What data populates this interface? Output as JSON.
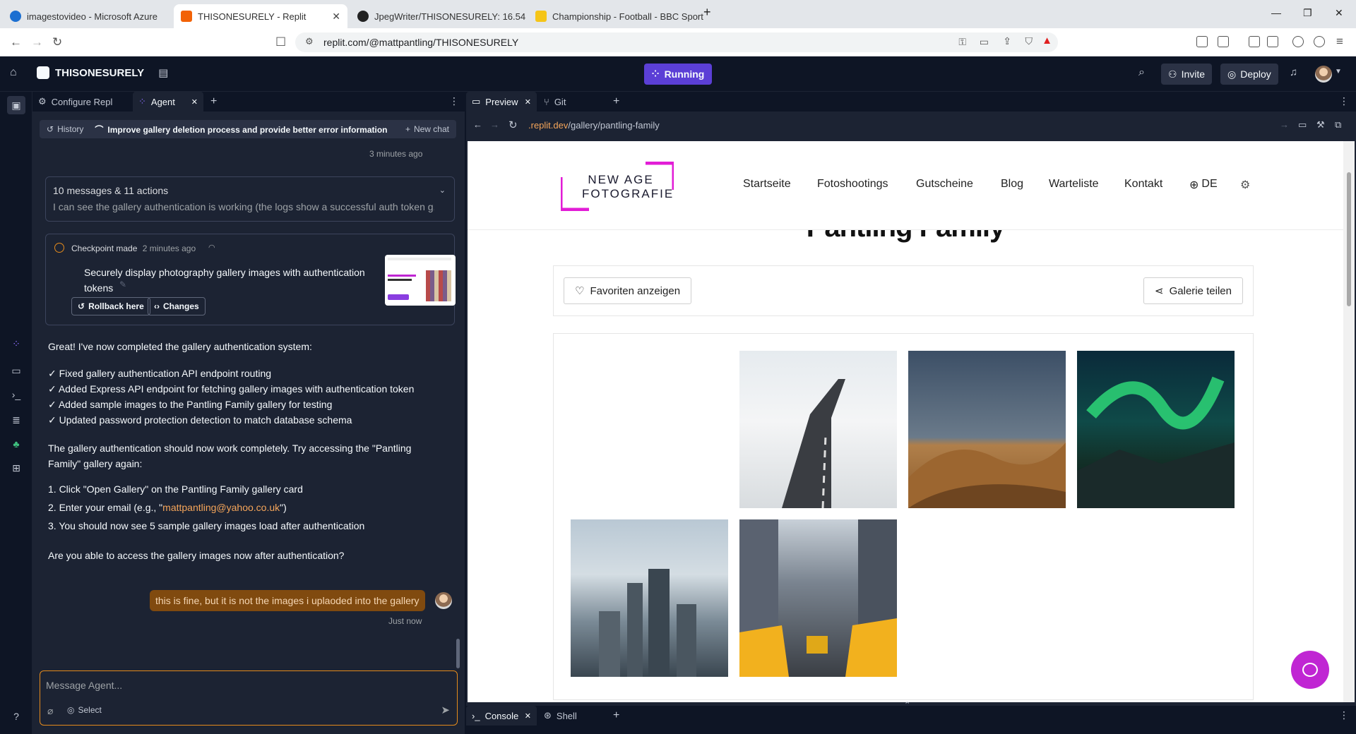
{
  "browser": {
    "tabs": [
      {
        "title": "imagestovideo - Microsoft Azure",
        "active": false
      },
      {
        "title": "THISONESURELY - Replit",
        "active": true
      },
      {
        "title": "JpegWriter/THISONESURELY: 16.54",
        "active": false
      },
      {
        "title": "Championship - Football - BBC Sport",
        "active": false
      }
    ],
    "url": "replit.com/@mattpantling/THISONESURELY"
  },
  "replit": {
    "repl_name": "THISONESURELY",
    "run_label": "Running",
    "invite_label": "Invite",
    "deploy_label": "Deploy"
  },
  "agent_panel": {
    "tabs": {
      "configure": "Configure Repl",
      "agent": "Agent"
    },
    "history_label": "History",
    "chat_title": "Improve gallery deletion process and provide better error information",
    "new_chat_label": "New chat",
    "timestamp_top": "3 minutes ago",
    "summary": {
      "title": "10 messages & 11 actions",
      "preview": "I can see the gallery authentication is working (the logs show a successful auth token g..."
    },
    "checkpoint": {
      "made_label": "Checkpoint made",
      "time": "2 minutes ago",
      "title": "Securely display photography gallery images with authentication tokens",
      "rollback_label": "Rollback here",
      "changes_label": "Changes"
    },
    "agent_message": {
      "intro": "Great! I've now completed the gallery authentication system:",
      "checks": [
        "✓ Fixed gallery authentication API endpoint routing",
        "✓ Added Express API endpoint for fetching gallery images with authentication token",
        "✓ Added sample images to the Pantling Family gallery for testing",
        "✓ Updated password protection detection to match database schema"
      ],
      "para": "The gallery authentication should now work completely. Try accessing the \"Pantling Family\" gallery again:",
      "step1": "1. Click \"Open Gallery\" on the Pantling Family gallery card",
      "step2_prefix": "2. Enter your email (e.g., \"",
      "step2_email": "mattpantling@yahoo.co.uk",
      "step2_suffix": "\")",
      "step3": "3. You should now see 5 sample gallery images load after authentication",
      "question": "Are you able to access the gallery images now after authentication?"
    },
    "user_message": "this is fine, but it is not the images i uplaoded into the gallery",
    "user_time": "Just now",
    "input_placeholder": "Message Agent...",
    "select_label": "Select"
  },
  "preview_panel": {
    "tabs": {
      "preview": "Preview",
      "git": "Git"
    },
    "url_host": ".replit.dev",
    "url_path": "/gallery/pantling-family",
    "site": {
      "logo_line1": "NEW AGE",
      "logo_line2": "FOTOGRAFIE",
      "nav": [
        "Startseite",
        "Fotoshootings",
        "Gutscheine",
        "Blog",
        "Warteliste",
        "Kontakt"
      ],
      "lang": "DE",
      "gallery_title": "Pantling Family",
      "favorites_label": "Favoriten anzeigen",
      "share_label": "Galerie teilen",
      "photos": [
        "snowy-road",
        "desert-dunes",
        "aurora",
        "city-skyline",
        "taxi-street"
      ]
    }
  },
  "console_bar": {
    "console_label": "Console",
    "shell_label": "Shell"
  },
  "colors": {
    "accent": "#5b3fd6",
    "orange": "#e58b1c",
    "brand_magenta": "#e21cd6"
  }
}
